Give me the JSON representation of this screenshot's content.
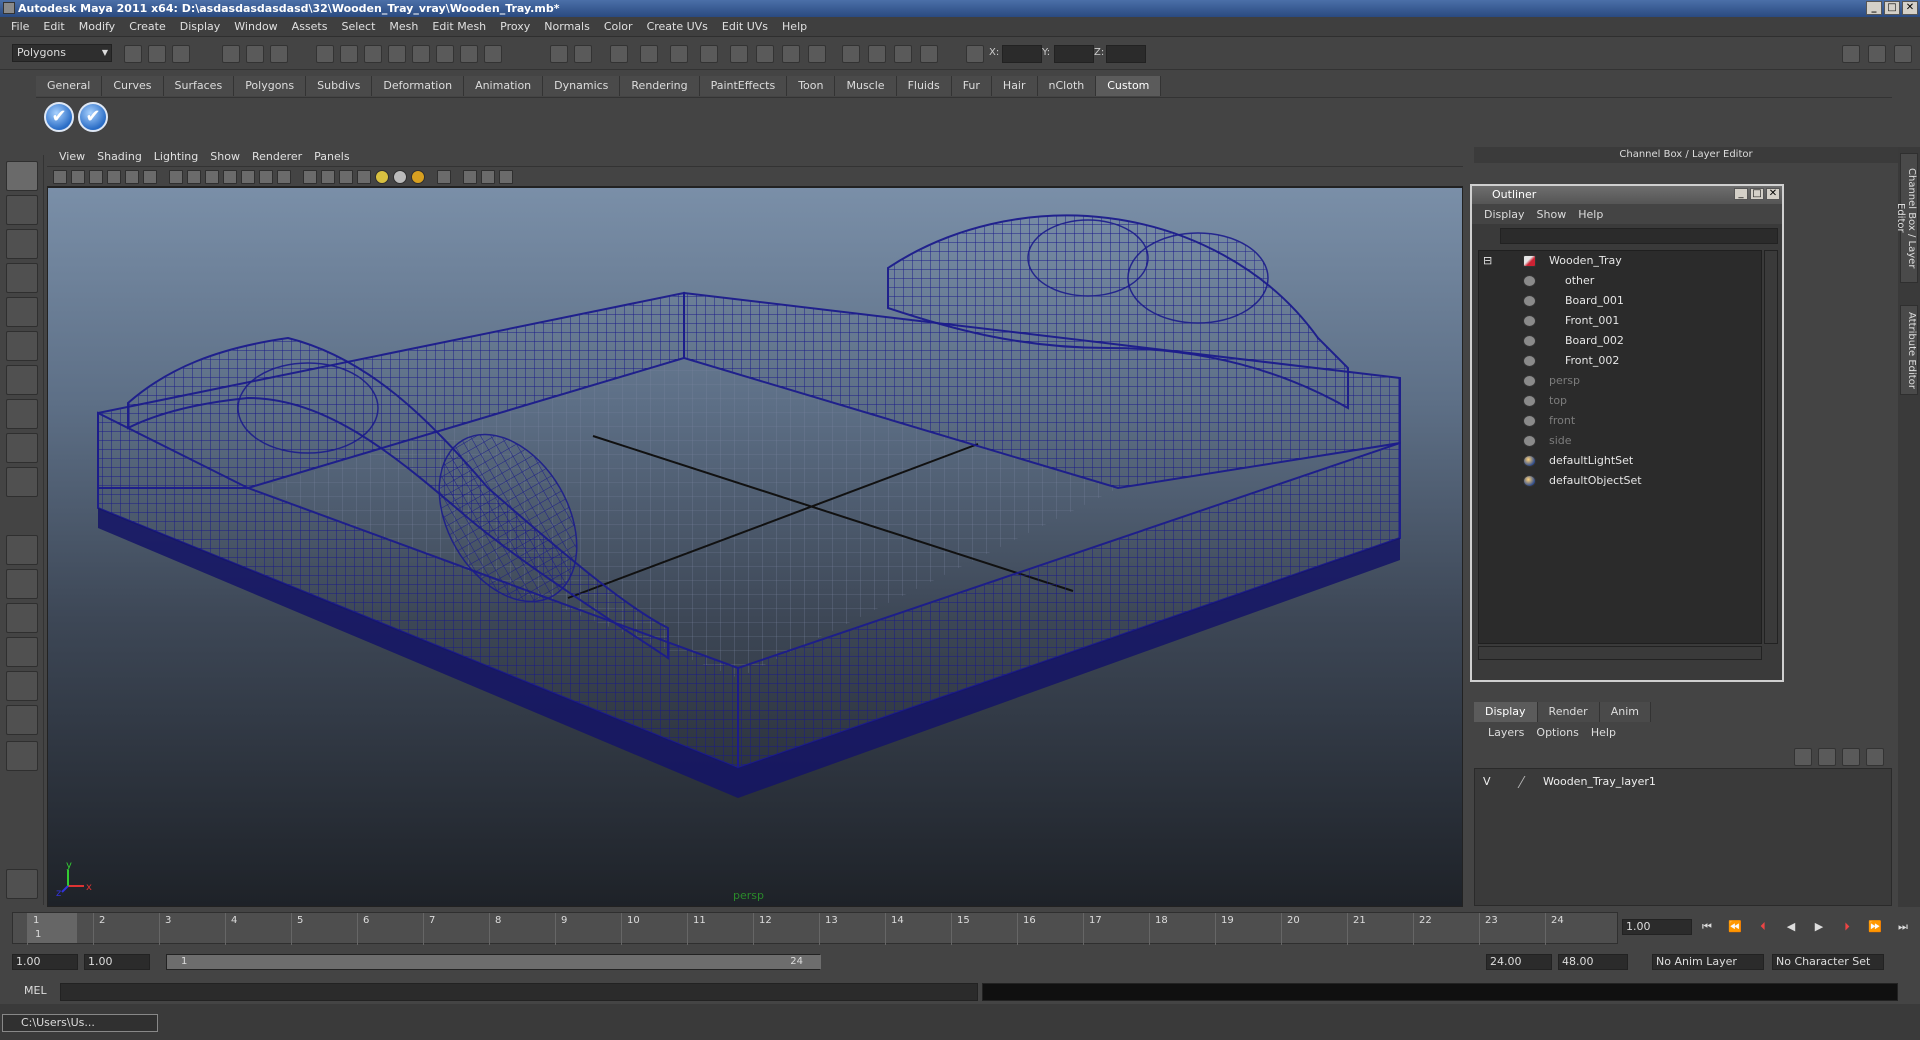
{
  "window": {
    "title": "Autodesk Maya 2011 x64: D:\\asdasdasdasdasd\\32\\Wooden_Tray_vray\\Wooden_Tray.mb*",
    "btn_min": "_",
    "btn_max": "□",
    "btn_close": "✕"
  },
  "menu": [
    "File",
    "Edit",
    "Modify",
    "Create",
    "Display",
    "Window",
    "Assets",
    "Select",
    "Mesh",
    "Edit Mesh",
    "Proxy",
    "Normals",
    "Color",
    "Create UVs",
    "Edit UVs",
    "Help"
  ],
  "status": {
    "mode": "Polygons",
    "x_label": "X:",
    "y_label": "Y:",
    "z_label": "Z:"
  },
  "shelf": {
    "tabs": [
      "General",
      "Curves",
      "Surfaces",
      "Polygons",
      "Subdivs",
      "Deformation",
      "Animation",
      "Dynamics",
      "Rendering",
      "PaintEffects",
      "Toon",
      "Muscle",
      "Fluids",
      "Fur",
      "Hair",
      "nCloth",
      "Custom"
    ],
    "active_tab": "Custom"
  },
  "viewport": {
    "menu": [
      "View",
      "Shading",
      "Lighting",
      "Show",
      "Renderer",
      "Panels"
    ],
    "camera": "persp",
    "axis_x": "x",
    "axis_y": "y",
    "axis_z": "z"
  },
  "channel_box": {
    "header": "Channel Box / Layer Editor",
    "side_tab_1": "Channel Box / Layer Editor",
    "side_tab_2": "Attribute Editor"
  },
  "outliner": {
    "title": "Outliner",
    "menu": [
      "Display",
      "Show",
      "Help"
    ],
    "root": "Wooden_Tray",
    "children": [
      "other",
      "Board_001",
      "Front_001",
      "Board_002",
      "Front_002"
    ],
    "cameras": [
      "persp",
      "top",
      "front",
      "side"
    ],
    "sets": [
      "defaultLightSet",
      "defaultObjectSet"
    ]
  },
  "layer_editor": {
    "tabs": [
      "Display",
      "Render",
      "Anim"
    ],
    "active_tab": "Display",
    "menu": [
      "Layers",
      "Options",
      "Help"
    ],
    "layers": [
      {
        "visible": "V",
        "name": "Wooden_Tray_layer1"
      }
    ]
  },
  "time": {
    "ticks": [
      "1",
      "2",
      "3",
      "4",
      "5",
      "6",
      "7",
      "8",
      "9",
      "10",
      "11",
      "12",
      "13",
      "14",
      "15",
      "16",
      "17",
      "18",
      "19",
      "20",
      "21",
      "22",
      "23",
      "24"
    ],
    "current_frame": "1.00",
    "cursor_label": "1",
    "range_start": "1.00",
    "range_inner_start": "1.00",
    "range_slider_start": "1",
    "range_slider_end": "24",
    "range_inner_end": "24.00",
    "range_end": "48.00",
    "anim_layer": "No Anim Layer",
    "character_set": "No Character Set"
  },
  "command": {
    "label": "MEL"
  },
  "taskbar": {
    "window": "C:\\Users\\Us..."
  }
}
